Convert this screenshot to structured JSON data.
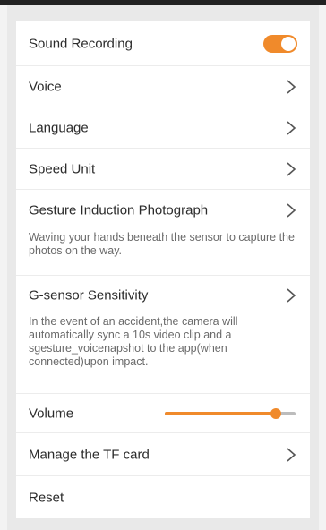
{
  "colors": {
    "accent": "#f08a2b",
    "text": "#2b2b2b",
    "muted": "#6a6a6a"
  },
  "settings": {
    "sound_recording": {
      "label": "Sound Recording",
      "enabled": true
    },
    "voice": {
      "label": "Voice"
    },
    "language": {
      "label": "Language"
    },
    "speed_unit": {
      "label": "Speed Unit"
    },
    "gesture": {
      "label": "Gesture Induction Photograph",
      "description": "Waving your hands beneath the sensor to capture the photos on the way."
    },
    "gsensor": {
      "label": "G-sensor Sensitivity",
      "description": "In the event of an accident,the camera will automatically sync a 10s video clip and a sgesture_voicenapshot to the app(when connected)upon impact."
    },
    "volume": {
      "label": "Volume",
      "level_fraction": 0.85
    },
    "tf_card": {
      "label": "Manage the TF card"
    },
    "reset": {
      "label": "Reset"
    }
  }
}
